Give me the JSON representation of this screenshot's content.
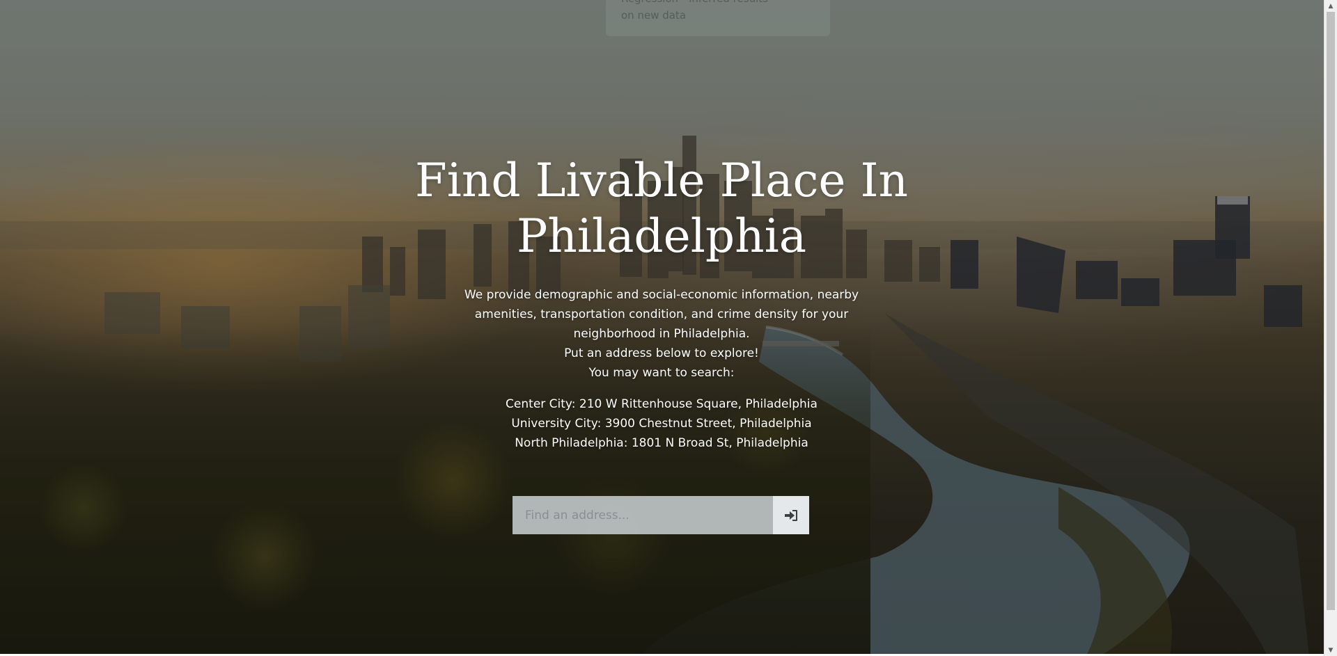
{
  "toast": {
    "line1": "Regression - Inferred results",
    "line2": "on new data"
  },
  "hero": {
    "title_line1": "Find Livable Place In",
    "title_line2": "Philadelphia",
    "description": [
      "We provide demographic and social-economic information, nearby amenities, transportation condition, and crime density for your neighborhood in Philadelphia.",
      "Put an address below to explore!",
      "You may want to search:"
    ],
    "examples": [
      "Center City: 210 W Rittenhouse Square, Philadelphia",
      "University City: 3900 Chestnut Street, Philadelphia",
      "North Philadelphia: 1801 N Broad St, Philadelphia"
    ]
  },
  "search": {
    "placeholder": "Find an address...",
    "value": "",
    "submit_icon": "sign-in-icon"
  },
  "scrollbar": {
    "up_icon": "arrow-up-icon",
    "down_icon": "arrow-down-icon"
  },
  "colors": {
    "text": "#ffffff",
    "input_bg": "#bec3c5",
    "button_bg": "#e4e8ea",
    "icon": "#3a3f44"
  }
}
